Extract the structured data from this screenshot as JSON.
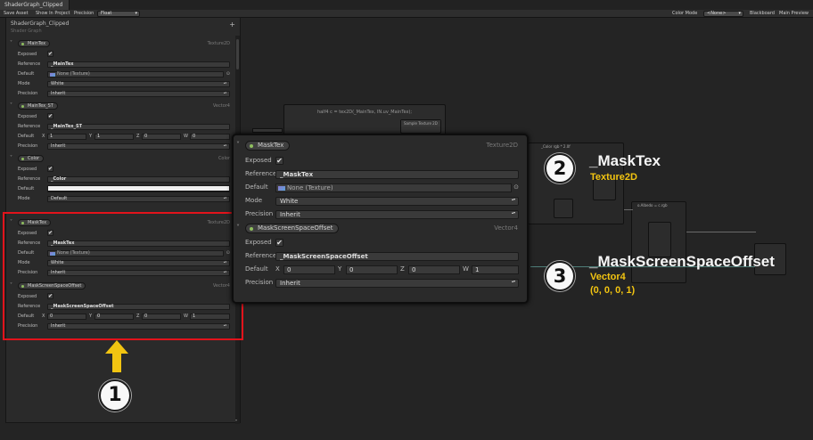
{
  "window": {
    "tab_title": "ShaderGraph_Clipped"
  },
  "toolbar": {
    "save_asset": "Save Asset",
    "show_in_project": "Show In Project",
    "precision_label": "Precision",
    "precision_value": "Float",
    "color_mode_label": "Color Mode",
    "color_mode_value": "<None>",
    "blackboard": "Blackboard",
    "main_preview": "Main Preview"
  },
  "blackboard": {
    "title": "ShaderGraph_Clipped",
    "subtitle": "Shader Graph",
    "add": "+",
    "scroll_arrow": "▾",
    "properties": [
      {
        "name": "MainTex",
        "type": "Texture2D",
        "exposed": true,
        "reference": "_MainTex",
        "default": "None (Texture)",
        "mode": "White",
        "precision": "Inherit"
      },
      {
        "name": "MainTex_ST",
        "type": "Vector4",
        "exposed": true,
        "reference": "_MainTex_ST",
        "default": {
          "x": "1",
          "y": "1",
          "z": "0",
          "w": "0"
        },
        "precision": "Inherit"
      },
      {
        "name": "Color",
        "type": "Color",
        "exposed": true,
        "reference": "_Color",
        "mode": "Default",
        "precision": "Inherit",
        "color": "#efefef"
      },
      {
        "name": "MaskTex",
        "type": "Texture2D",
        "exposed": true,
        "reference": "_MaskTex",
        "default": "None (Texture)",
        "mode": "White",
        "precision": "Inherit"
      },
      {
        "name": "MaskScreenSpaceOffset",
        "type": "Vector4",
        "exposed": true,
        "reference": "_MaskScreenSpaceOffset",
        "default": {
          "x": "0",
          "y": "0",
          "z": "0",
          "w": "1"
        },
        "precision": "Inherit"
      }
    ]
  },
  "labels": {
    "exposed": "Exposed",
    "reference": "Reference",
    "default": "Default",
    "mode": "Mode",
    "precision": "Precision",
    "x": "X",
    "y": "Y",
    "z": "Z",
    "w": "W",
    "check": "✔",
    "object_picker": "⊙",
    "chevron": "˅"
  },
  "graph": {
    "custom_node_code": "half4 c = tex2D(_MainTex, IN.uv_MainTex);",
    "sample_texture": "Sample Texture 2D",
    "color_node": "_Color rgb * 2.0f",
    "albedo_node": "o.Albedo = c.rgb"
  },
  "callouts": [
    {
      "number": "1"
    },
    {
      "number": "2",
      "name": "_MaskTex",
      "type": "Texture2D"
    },
    {
      "number": "3",
      "name": "_MaskScreenSpaceOffset",
      "type": "Vector4",
      "value": "(0, 0, 0, 1)"
    }
  ],
  "colors": {
    "highlight_red": "#e2131b",
    "arrow_yellow": "#f2c411",
    "type_text": "#f2c411"
  }
}
